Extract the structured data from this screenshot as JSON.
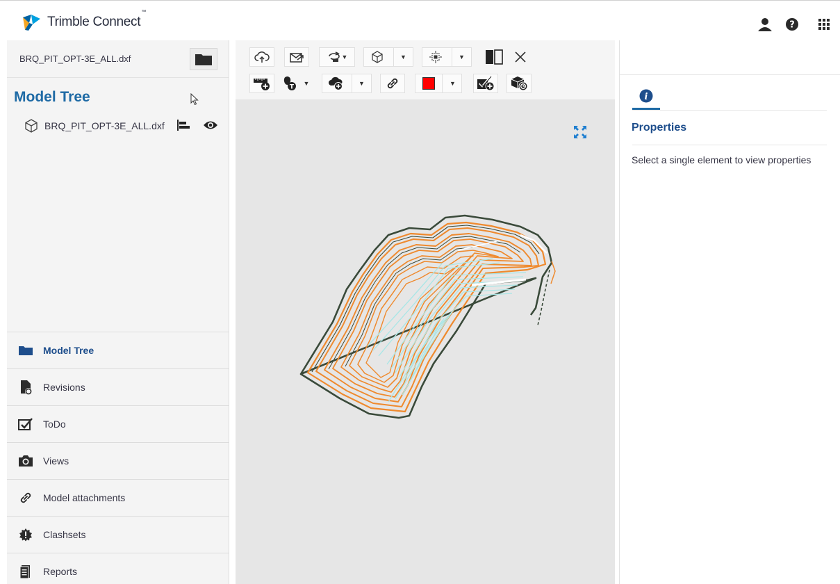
{
  "app": {
    "name": "Trimble Connect",
    "tm": "™"
  },
  "header": {
    "icons": [
      "user-icon",
      "help-icon",
      "apps-grid-icon"
    ]
  },
  "left": {
    "file_name": "BRQ_PIT_OPT-3E_ALL.dxf",
    "tree_title": "Model Tree",
    "tree_items": [
      {
        "label": "BRQ_PIT_OPT-3E_ALL.dxf",
        "icon": "cube-outline-icon"
      }
    ],
    "nav": [
      {
        "label": "Model Tree",
        "icon": "folder-icon",
        "active": true
      },
      {
        "label": "Revisions",
        "icon": "revisions-icon",
        "active": false
      },
      {
        "label": "ToDo",
        "icon": "todo-check-icon",
        "active": false
      },
      {
        "label": "Views",
        "icon": "camera-icon",
        "active": false
      },
      {
        "label": "Model attachments",
        "icon": "link-icon",
        "active": false
      },
      {
        "label": "Clashsets",
        "icon": "clash-icon",
        "active": false
      },
      {
        "label": "Reports",
        "icon": "report-icon",
        "active": false
      }
    ]
  },
  "toolbar": {
    "buttons": [
      "reload-cloud-icon",
      "share-view-icon",
      "rotate-icon",
      "view-cube-icon",
      "fit-selection-icon",
      "split-view-icon",
      "close-icon",
      "measure-add-icon",
      "markup-icon",
      "cloud-add-icon",
      "link-icon",
      "color-red-swatch",
      "todo-add-icon",
      "model-status-icon"
    ],
    "accent_red": "#ff0000"
  },
  "right": {
    "properties_title": "Properties",
    "properties_message": "Select a single element to view properties"
  },
  "colors": {
    "brand_blue": "#1e6aa5",
    "contour_orange": "#ef8a2e",
    "contour_cyan": "#a9e6e6",
    "outline_dark": "#3a4a3a"
  }
}
